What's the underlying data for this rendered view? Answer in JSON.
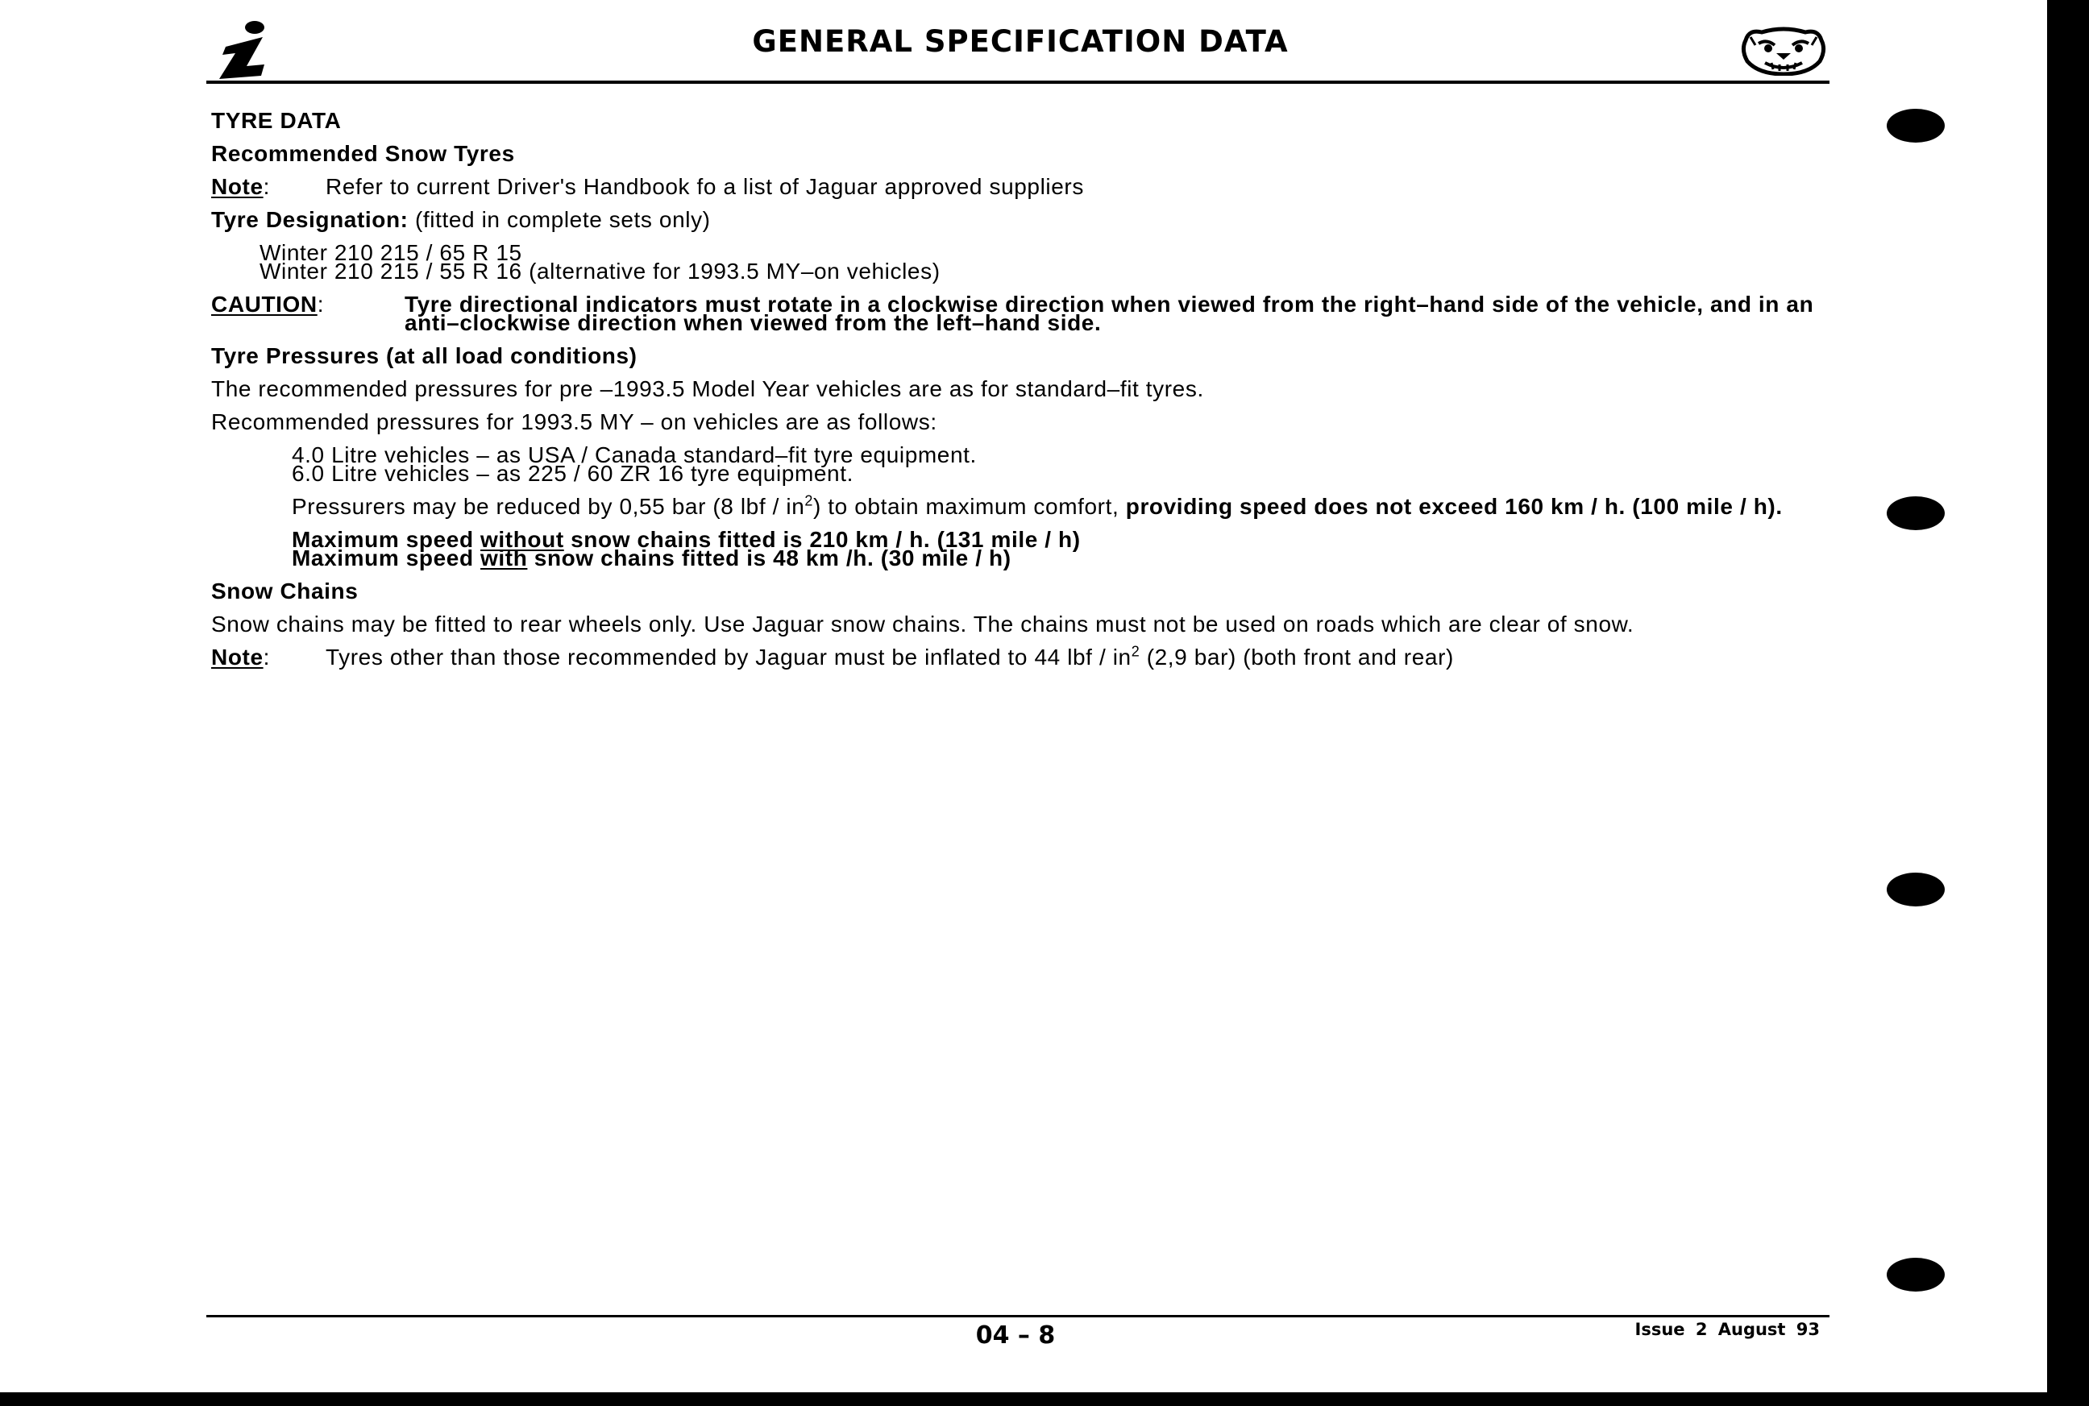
{
  "header": {
    "title": "GENERAL SPECIFICATION DATA",
    "info_icon": "info-i-icon",
    "emblem_icon": "jaguar-head-emblem-icon"
  },
  "tyre_data": {
    "heading": "TYRE DATA",
    "snow_tyres_heading": "Recommended Snow Tyres",
    "note1_label": "Note",
    "note1_text": "Refer to current Driver's Handbook fo a list of Jaguar approved suppliers",
    "designation_label": "Tyre Designation:",
    "designation_text": "(fitted in complete sets only)",
    "designation_lines": [
      "Winter 210 215 / 65  R 15",
      "Winter 210 215 / 55 R 16  (alternative for 1993.5 MY–on vehicles)"
    ],
    "caution_label": "CAUTION",
    "caution_text": "Tyre directional indicators must rotate in a clockwise direction when viewed from the right–hand side of the vehicle, and in an anti–clockwise direction when viewed from the left–hand side.",
    "pressures_heading": "Tyre Pressures (at all load conditions)",
    "pressures_p1": "The recommended pressures for pre –1993.5 Model Year vehicles are as for standard–fit tyres.",
    "pressures_p2": "Recommended pressures for 1993.5 MY  – on vehicles are as follows:",
    "pressures_lines": [
      "4.0 Litre vehicles – as USA / Canada standard–fit tyre equipment.",
      "6.0 Litre vehicles – as 225 / 60 ZR 16 tyre equipment."
    ],
    "reduce_a": "Pressurers may be reduced by 0,55 bar (8 lbf / in",
    "reduce_sup": "2",
    "reduce_b": ") to obtain maximum comfort, ",
    "reduce_bold": "providing speed does not exceed 160 km / h. (100 mile / h).",
    "max1_a": "Maximum speed ",
    "max1_u": "without",
    "max1_b": " snow chains fitted is 210 km / h. (131 mile / h)",
    "max2_a": "Maximum speed ",
    "max2_u": "with",
    "max2_b": " snow chains fitted is 48 km /h. (30 mile / h)",
    "chains_heading": "Snow Chains",
    "chains_text": "Snow chains may be fitted to rear wheels only.  Use Jaguar snow chains.  The chains must not be used on roads which are clear of snow.",
    "note2_label": "Note",
    "note2_a": "Tyres other than those recommended by Jaguar must be inflated to 44 lbf / in",
    "note2_sup": "2",
    "note2_b": " (2,9 bar) (both front and rear)"
  },
  "footer": {
    "page_number": "04 – 8",
    "issue": "Issue 2   August 93"
  }
}
